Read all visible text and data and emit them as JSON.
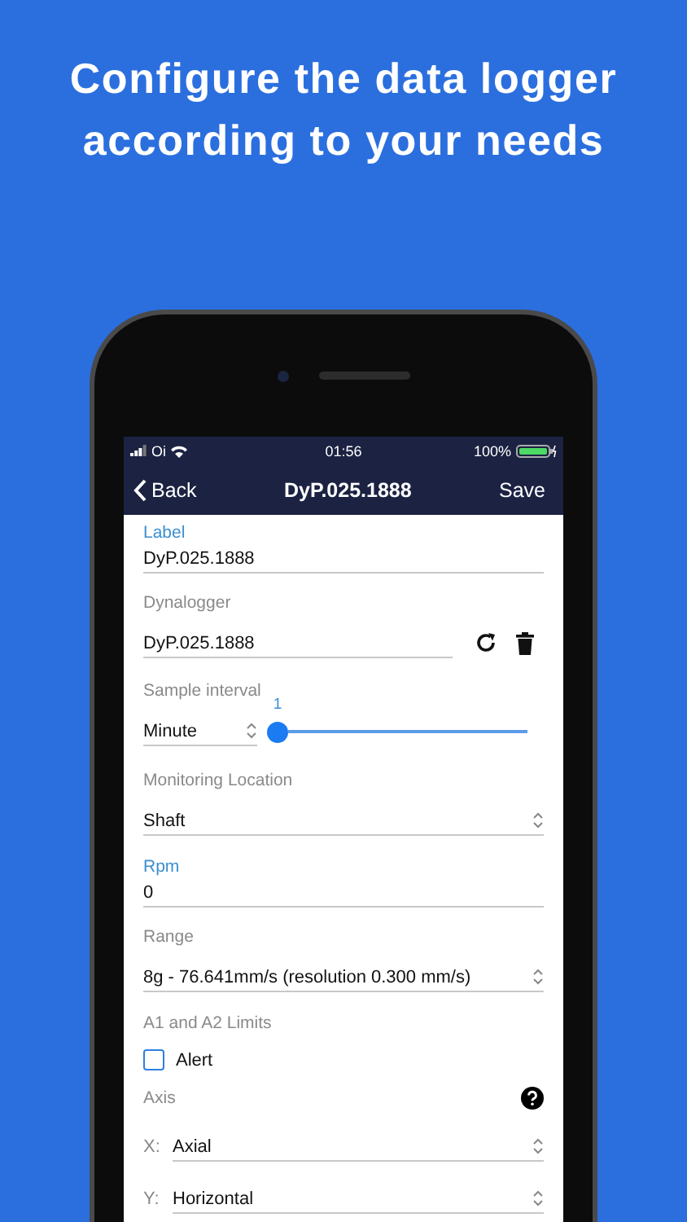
{
  "headline": "Configure the data logger according to your needs",
  "status_bar": {
    "carrier": "Oi",
    "time": "01:56",
    "battery": "100%"
  },
  "nav": {
    "back": "Back",
    "title": "DyP.025.1888",
    "action": "Save"
  },
  "fields": [
    {
      "kind": "text",
      "label": "Label",
      "value": "DyP.025.1888"
    },
    {
      "kind": "logger",
      "label": "Dynalogger",
      "value": "DyP.025.1888"
    },
    {
      "kind": "interval",
      "label": "Sample interval",
      "unit": "Minute",
      "reading": "1",
      "level": 0
    },
    {
      "kind": "select",
      "label": "Monitoring Location",
      "value": "Shaft"
    },
    {
      "kind": "text",
      "label": "Rpm",
      "value": "0"
    },
    {
      "kind": "select",
      "label": "Range",
      "value": "8g - 76.641mm/s (resolution 0.300 mm/s)"
    },
    {
      "kind": "checkbox",
      "label": "A1 and A2 Limits",
      "option": "Alert",
      "checked": false
    },
    {
      "kind": "axis",
      "label": "Axis",
      "axes": [
        {
          "name": "X:",
          "value": "Axial"
        },
        {
          "name": "Y:",
          "value": "Horizontal"
        }
      ]
    }
  ]
}
